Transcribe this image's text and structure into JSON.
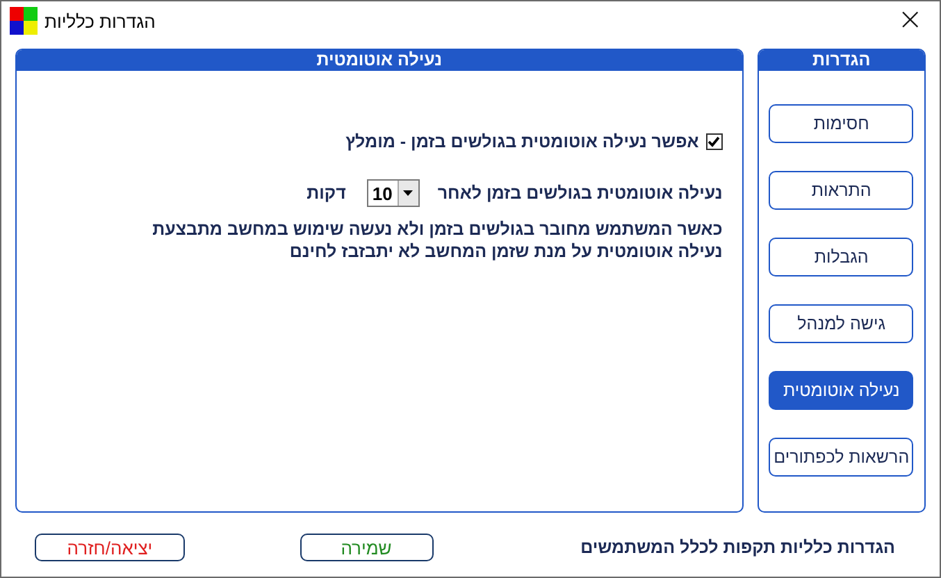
{
  "window": {
    "title": "הגדרות כלליות",
    "close": "×"
  },
  "panel": {
    "title": "נעילה אוטומטית",
    "enable": {
      "label": "אפשר נעילה אוטומטית בגולשים בזמן - מומלץ",
      "checked": true
    },
    "timeout": {
      "label": "נעילה אוטומטית בגולשים בזמן לאחר",
      "value": "10",
      "unit": "דקות"
    },
    "description": [
      "כאשר המשתמש מחובר בגולשים בזמן ולא נעשה שימוש במחשב מתבצעת",
      "נעילה אוטומטית על מנת שזמן המחשב לא יתבזבז לחינם"
    ]
  },
  "sidebar": {
    "title": "הגדרות",
    "items": [
      {
        "label": "חסימות",
        "selected": false
      },
      {
        "label": "התראות",
        "selected": false
      },
      {
        "label": "הגבלות",
        "selected": false
      },
      {
        "label": "גישה למנהל",
        "selected": false
      },
      {
        "label": "נעילה אוטומטית",
        "selected": true
      },
      {
        "label": "הרשאות לכפתורים",
        "selected": false
      }
    ]
  },
  "footer": {
    "note": "הגדרות כלליות תקפות לכלל המשתמשים",
    "buttons": [
      {
        "label": "שמירה",
        "kind": "save"
      },
      {
        "label": "יציאה/חזרה",
        "kind": "exit"
      }
    ]
  }
}
